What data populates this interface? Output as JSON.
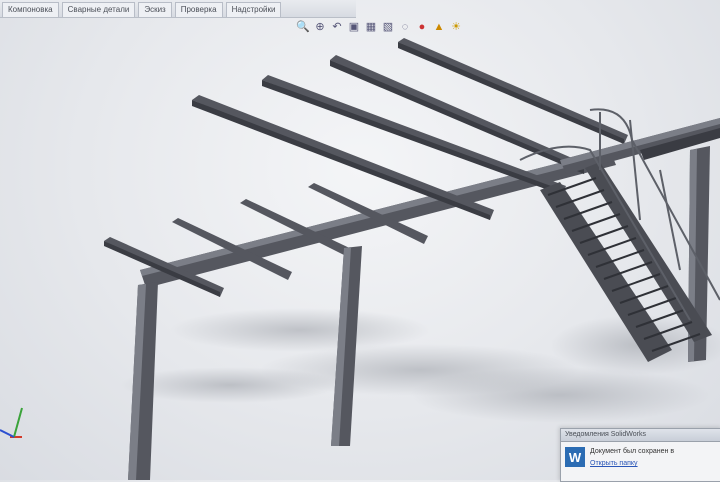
{
  "tabs": [
    {
      "label": "Компоновка"
    },
    {
      "label": "Сварные детали"
    },
    {
      "label": "Эскиз"
    },
    {
      "label": "Проверка"
    },
    {
      "label": "Надстройки"
    }
  ],
  "heads_up_toolbar": {
    "icons": [
      "zoom-to-fit-icon",
      "zoom-area-icon",
      "previous-view-icon",
      "section-view-icon",
      "view-orientation-icon",
      "display-style-icon",
      "hide-show-icon",
      "edit-appearance-icon",
      "apply-scene-icon",
      "view-settings-icon"
    ]
  },
  "notification": {
    "title": "Уведомления SolidWorks",
    "message": "Документ был сохранен в",
    "link": "Открыть папку"
  },
  "colors": {
    "steel": "#55575f",
    "steel_dark": "#3a3c43",
    "steel_light": "#7b7e87",
    "background": "#e6e8ec",
    "triad_x": "#d23a2a",
    "triad_y": "#3aa33a",
    "triad_z": "#2b4fd0"
  }
}
